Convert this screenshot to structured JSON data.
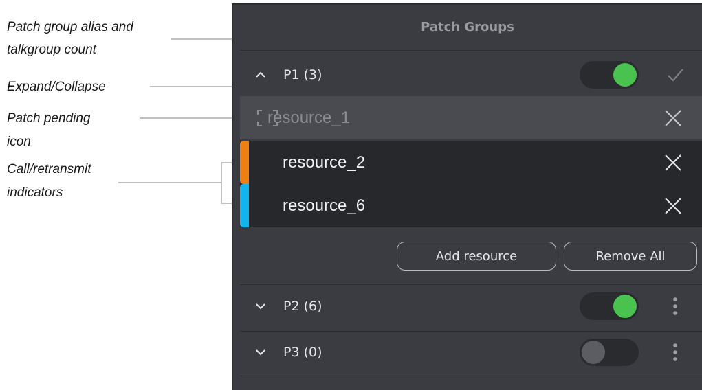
{
  "annotations": {
    "alias_line1": "Patch group alias and",
    "alias_line2": "talkgroup count",
    "expand": "Expand/Collapse",
    "pending_line1": "Patch pending",
    "pending_line2": "icon",
    "call_line1": "Call/retransmit",
    "call_line2": "indicators"
  },
  "panel": {
    "title": "Patch Groups",
    "groups": [
      {
        "label": "P1 (3)",
        "expanded": true,
        "enabled": true,
        "action_icon": "checkmark-icon",
        "resources": [
          {
            "name": "resource_1",
            "state": "pending"
          },
          {
            "name": "resource_2",
            "state": "call",
            "indicator_color": "#f07f13"
          },
          {
            "name": "resource_6",
            "state": "retransmit",
            "indicator_color": "#13b4ee"
          }
        ],
        "buttons": {
          "add": "Add resource",
          "remove_all": "Remove All"
        }
      },
      {
        "label": "P2 (6)",
        "expanded": false,
        "enabled": true,
        "action_icon": "kebab-menu-icon"
      },
      {
        "label": "P3 (0)",
        "expanded": false,
        "enabled": false,
        "action_icon": "kebab-menu-icon"
      }
    ]
  },
  "colors": {
    "panel_bg": "#3b3c41",
    "toggle_on": "#49c24f",
    "toggle_off": "#5b5d63",
    "call_indicator": "#f07f13",
    "retransmit_indicator": "#13b4ee"
  }
}
